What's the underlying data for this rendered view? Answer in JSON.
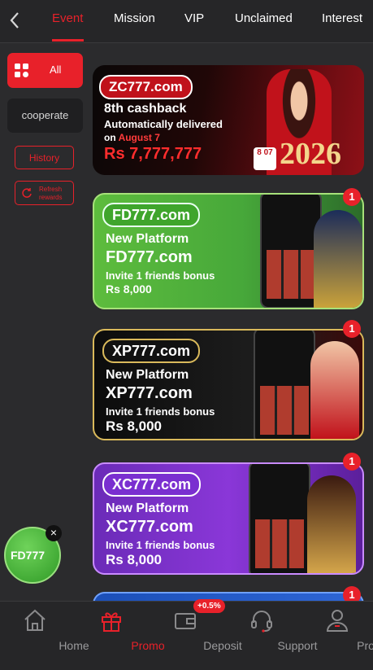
{
  "header": {
    "tabs": [
      {
        "label": "Event"
      },
      {
        "label": "Mission"
      },
      {
        "label": "VIP"
      },
      {
        "label": "Unclaimed"
      },
      {
        "label": "Interest"
      }
    ]
  },
  "sidebar": {
    "all_label": "All",
    "cooperate_label": "cooperate",
    "history_label": "History",
    "refresh_label": "Refresh rewards"
  },
  "banners": [
    {
      "logo": "ZC777.com",
      "line1": "8th cashback",
      "line2": "Automatically delivered",
      "line3_prefix": "on ",
      "line3_date": "August 7",
      "amount": "Rs 7,777,777",
      "year": "2026",
      "calendar": "8 07"
    },
    {
      "logo": "FD777.com",
      "platform": "New Platform",
      "brand": "FD777.com",
      "invite": "Invite 1 friends bonus",
      "bonus": "Rs 8,000",
      "badge": "1"
    },
    {
      "logo": "XP777.com",
      "platform": "New Platform",
      "brand": "XP777.com",
      "invite": "Invite 1 friends bonus",
      "bonus": "Rs 8,000",
      "badge": "1"
    },
    {
      "logo": "XC777.com",
      "platform": "New Platform",
      "brand": "XC777.com",
      "invite": "Invite 1 friends bonus",
      "bonus": "Rs 8,000",
      "badge": "1"
    },
    {
      "badge": "1"
    }
  ],
  "floating": {
    "logo": "FD777",
    "close": "×"
  },
  "bottom_nav": {
    "items": [
      {
        "label": "Home",
        "icon": "home-icon"
      },
      {
        "label": "Promo",
        "icon": "gift-icon"
      },
      {
        "label": "Deposit",
        "icon": "wallet-icon"
      },
      {
        "label": "Support",
        "icon": "headset-icon"
      },
      {
        "label": "Profile",
        "icon": "person-icon"
      }
    ],
    "deposit_badge": "+0.5%"
  },
  "colors": {
    "accent": "#e8212a",
    "background": "#2b2b2d",
    "bar": "#262628"
  }
}
